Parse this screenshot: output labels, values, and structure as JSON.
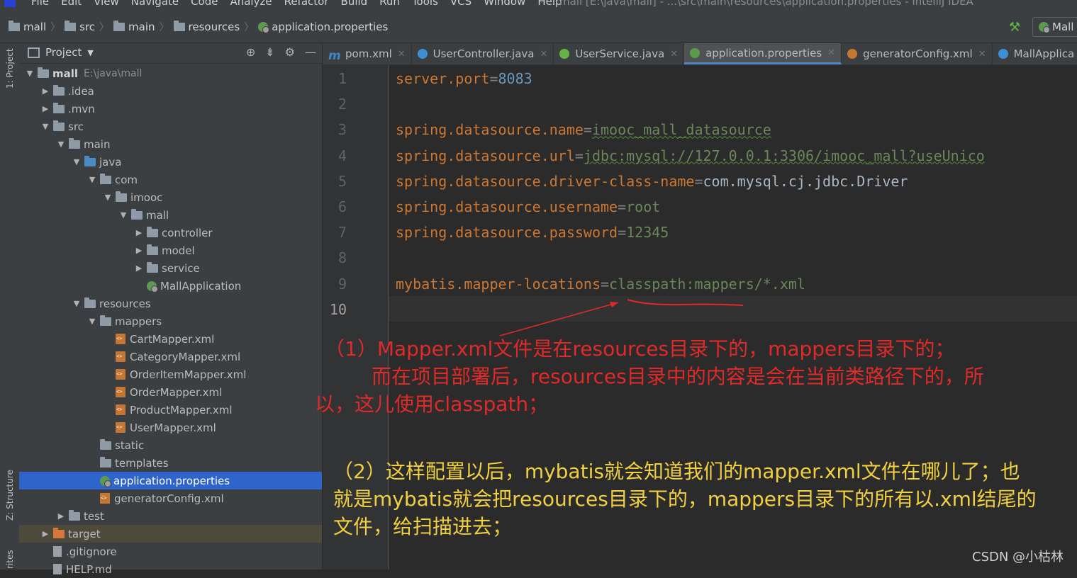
{
  "menubar": {
    "items": [
      "File",
      "Edit",
      "View",
      "Navigate",
      "Code",
      "Analyze",
      "Refactor",
      "Build",
      "Run",
      "Tools",
      "VCS",
      "Window",
      "Help"
    ],
    "window_title": "mall [E:\\java\\mall] - ...\\src\\main\\resources\\application.properties - IntelliJ IDEA"
  },
  "breadcrumb": [
    "mall",
    "src",
    "main",
    "resources",
    "application.properties"
  ],
  "run_config": "Mall",
  "left_strip": {
    "project_label": "1: Project",
    "structure_label": "Z: Structure",
    "favorites_label": "rites"
  },
  "project": {
    "title": "Project",
    "root": {
      "name": "mall",
      "path": "E:\\java\\mall"
    },
    "tree": [
      {
        "label": "mall",
        "indent": 0,
        "arrow": "down",
        "icon": "module"
      },
      {
        "label": ".idea",
        "indent": 1,
        "arrow": "right",
        "icon": "folder"
      },
      {
        "label": ".mvn",
        "indent": 1,
        "arrow": "right",
        "icon": "folder"
      },
      {
        "label": "src",
        "indent": 1,
        "arrow": "down",
        "icon": "folder"
      },
      {
        "label": "main",
        "indent": 2,
        "arrow": "down",
        "icon": "folder"
      },
      {
        "label": "java",
        "indent": 3,
        "arrow": "down",
        "icon": "folder-blue"
      },
      {
        "label": "com",
        "indent": 4,
        "arrow": "down",
        "icon": "package"
      },
      {
        "label": "imooc",
        "indent": 5,
        "arrow": "down",
        "icon": "package"
      },
      {
        "label": "mall",
        "indent": 6,
        "arrow": "down",
        "icon": "package"
      },
      {
        "label": "controller",
        "indent": 7,
        "arrow": "right",
        "icon": "package"
      },
      {
        "label": "model",
        "indent": 7,
        "arrow": "right",
        "icon": "package"
      },
      {
        "label": "service",
        "indent": 7,
        "arrow": "right",
        "icon": "package"
      },
      {
        "label": "MallApplication",
        "indent": 7,
        "arrow": "none",
        "icon": "spring-class"
      },
      {
        "label": "resources",
        "indent": 3,
        "arrow": "down",
        "icon": "resources"
      },
      {
        "label": "mappers",
        "indent": 4,
        "arrow": "down",
        "icon": "folder"
      },
      {
        "label": "CartMapper.xml",
        "indent": 5,
        "arrow": "none",
        "icon": "xml"
      },
      {
        "label": "CategoryMapper.xml",
        "indent": 5,
        "arrow": "none",
        "icon": "xml"
      },
      {
        "label": "OrderItemMapper.xml",
        "indent": 5,
        "arrow": "none",
        "icon": "xml"
      },
      {
        "label": "OrderMapper.xml",
        "indent": 5,
        "arrow": "none",
        "icon": "xml"
      },
      {
        "label": "ProductMapper.xml",
        "indent": 5,
        "arrow": "none",
        "icon": "xml"
      },
      {
        "label": "UserMapper.xml",
        "indent": 5,
        "arrow": "none",
        "icon": "xml"
      },
      {
        "label": "static",
        "indent": 4,
        "arrow": "none",
        "icon": "folder"
      },
      {
        "label": "templates",
        "indent": 4,
        "arrow": "none",
        "icon": "folder"
      },
      {
        "label": "application.properties",
        "indent": 4,
        "arrow": "none",
        "icon": "properties",
        "selected": true
      },
      {
        "label": "generatorConfig.xml",
        "indent": 4,
        "arrow": "none",
        "icon": "xml"
      },
      {
        "label": "test",
        "indent": 2,
        "arrow": "right",
        "icon": "folder"
      },
      {
        "label": "target",
        "indent": 1,
        "arrow": "right",
        "icon": "folder-orange",
        "highlight": true
      },
      {
        "label": ".gitignore",
        "indent": 1,
        "arrow": "none",
        "icon": "file"
      },
      {
        "label": "HELP.md",
        "indent": 1,
        "arrow": "none",
        "icon": "file"
      }
    ]
  },
  "tabs": [
    {
      "label": "pom.xml",
      "icon": "maven-icon",
      "active": false
    },
    {
      "label": "UserController.java",
      "icon": "class-icon",
      "active": false
    },
    {
      "label": "UserService.java",
      "icon": "interface-icon",
      "active": false
    },
    {
      "label": "application.properties",
      "icon": "properties-icon",
      "active": true
    },
    {
      "label": "generatorConfig.xml",
      "icon": "xml-icon",
      "active": false
    },
    {
      "label": "MallApplica",
      "icon": "spring-class-icon",
      "active": false
    }
  ],
  "editor": {
    "current_line": 10,
    "lines": [
      {
        "n": "1",
        "key": "server.port",
        "eq": "=",
        "val": "8083",
        "val_kind": "num"
      },
      {
        "n": "2",
        "key": "",
        "eq": "",
        "val": "",
        "val_kind": "str"
      },
      {
        "n": "3",
        "key": "spring.datasource.name",
        "eq": "=",
        "val": "imooc_mall_datasource",
        "val_kind": "str"
      },
      {
        "n": "4",
        "key": "spring.datasource.url",
        "eq": "=",
        "val": "jdbc:mysql://127.0.0.1:3306/imooc_mall?useUnico",
        "val_kind": "str"
      },
      {
        "n": "5",
        "key": "spring.datasource.driver-class-name",
        "eq": "=",
        "val": "com.mysql.cj.jdbc.Driver",
        "val_kind": "class"
      },
      {
        "n": "6",
        "key": "spring.datasource.username",
        "eq": "=",
        "val": "root",
        "val_kind": "str"
      },
      {
        "n": "7",
        "key": "spring.datasource.password",
        "eq": "=",
        "val": "12345",
        "val_kind": "str"
      },
      {
        "n": "8",
        "key": "",
        "eq": "",
        "val": "",
        "val_kind": "str"
      },
      {
        "n": "9",
        "key": "mybatis.mapper-locations",
        "eq": "=",
        "val": "classpath:mappers/*.xml",
        "val_kind": "str"
      },
      {
        "n": "10",
        "key": "",
        "eq": "",
        "val": "",
        "val_kind": "str"
      }
    ]
  },
  "annotations": {
    "note1_line1": "（1）Mapper.xml文件是在resources目录下的，mappers目录下的；",
    "note1_line2": "而在项目部署后，resources目录中的内容是会在当前类路径下的，所",
    "note1_line3": "以，这儿使用classpath；",
    "note2_line1": "（2）这样配置以后，mybatis就会知道我们的mapper.xml文件在哪儿了；也",
    "note2_line2": "就是mybatis就会把resources目录下的，mappers目录下的所有以.xml结尾的",
    "note2_line3": "文件，给扫描进去；",
    "red_color": "#e02a2a",
    "yellow_color": "#f0d040"
  },
  "watermark": "CSDN @小枯林"
}
